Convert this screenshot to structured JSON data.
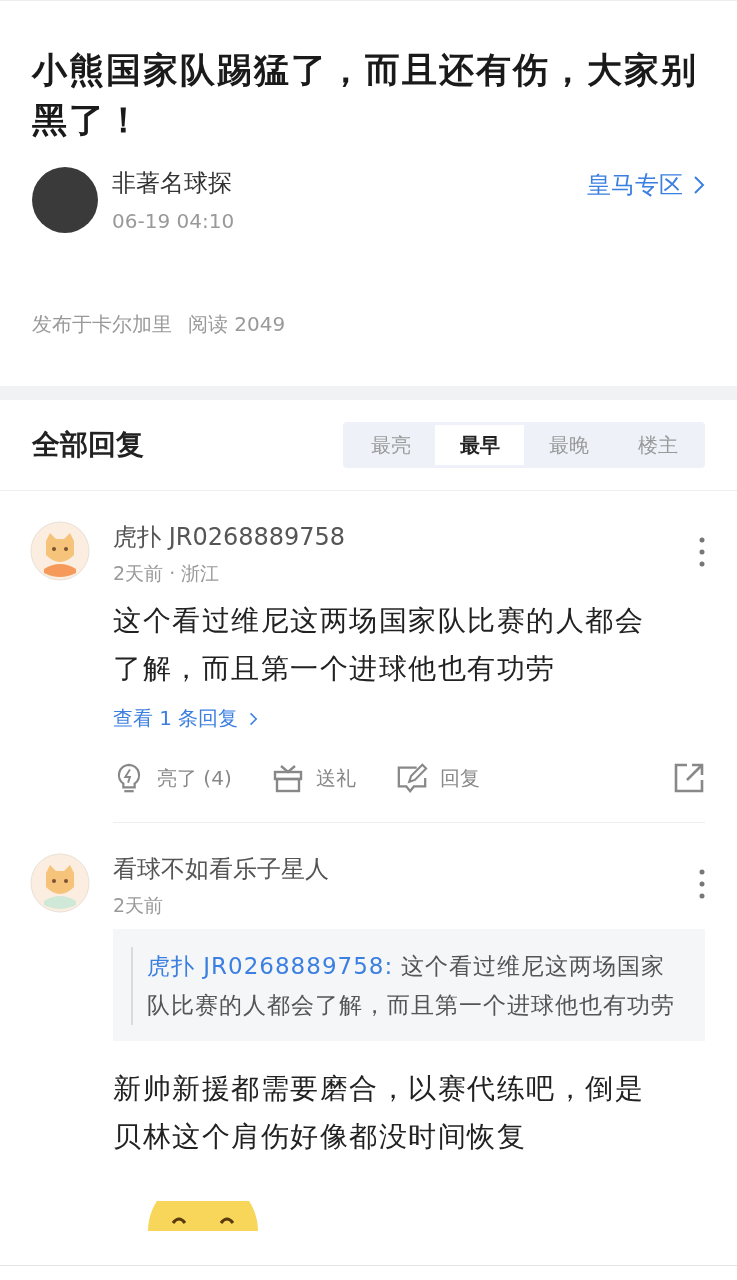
{
  "post": {
    "title": "小熊国家队踢猛了，而且还有伤，大家别黑了！",
    "author": "非著名球探",
    "time": "06-19 04:10",
    "section": "皇马专区",
    "meta": [
      "发布于卡尔加里",
      "阅读 2049"
    ]
  },
  "replies": {
    "heading": "全部回复",
    "tabs": [
      {
        "label": "最亮",
        "selected": false
      },
      {
        "label": "最早",
        "selected": true
      },
      {
        "label": "最晚",
        "selected": false
      },
      {
        "label": "楼主",
        "selected": false
      }
    ]
  },
  "comments": [
    {
      "user": "虎扑 JR0268889758",
      "info": "2天前 · 浙江",
      "body": "这个看过维尼这两场国家队比赛的人都会了解，而且第一个进球他也有功劳",
      "view_replies": "查看 1 条回复",
      "actions": [
        {
          "kind": "light",
          "label": "亮了 (4)"
        },
        {
          "kind": "gift",
          "label": "送礼"
        },
        {
          "kind": "reply",
          "label": "回复"
        },
        {
          "kind": "share"
        }
      ]
    },
    {
      "user": "看球不如看乐子星人",
      "info": "2天前",
      "quote": {
        "user": "虎扑 JR0268889758:",
        "text": "这个看过维尼这两场国家队比赛的人都会了解，而且第一个进球他也有功劳"
      },
      "body": "新帅新援都需要磨合，以赛代练吧，倒是贝林这个肩伤好像都没时间恢复",
      "emoji": true
    }
  ]
}
